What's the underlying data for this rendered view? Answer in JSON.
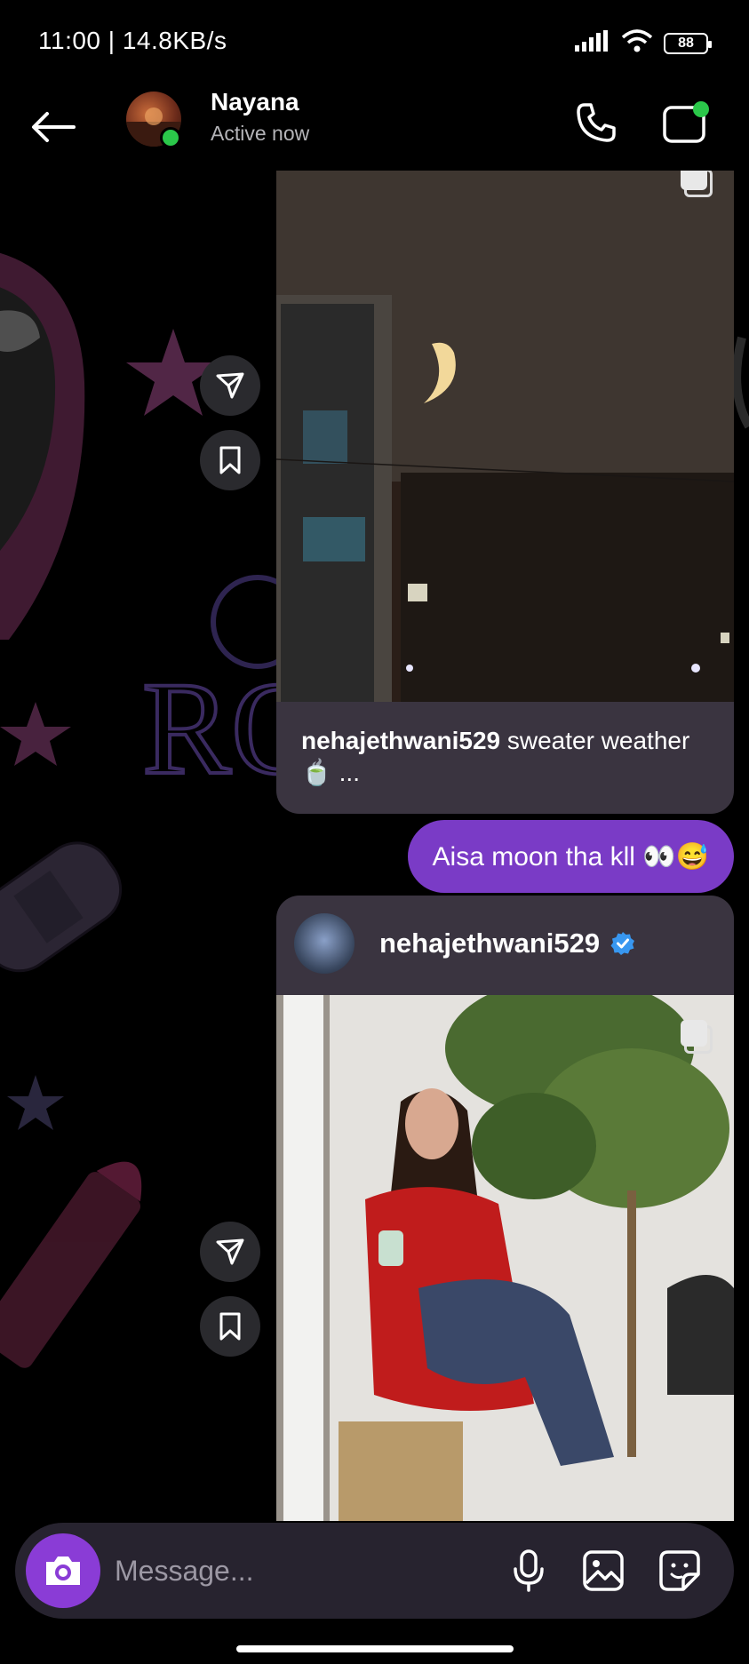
{
  "status_bar": {
    "time": "11:00 | 14.8KB/s",
    "battery": "88"
  },
  "header": {
    "contact_name": "Nayana",
    "contact_status": "Active now"
  },
  "messages": {
    "post1_caption_user": "nehajethwani529",
    "post1_caption_text": " sweater weather 🍵 ...",
    "my_reply": "Aisa moon tha kll 👀😅",
    "post2_user": "nehajethwani529"
  },
  "composer": {
    "placeholder": "Message..."
  },
  "colors": {
    "accent_purple": "#7a3bc6",
    "card_bg": "#3a3440",
    "online_green": "#2bc84a",
    "verified_blue": "#3897f0"
  }
}
